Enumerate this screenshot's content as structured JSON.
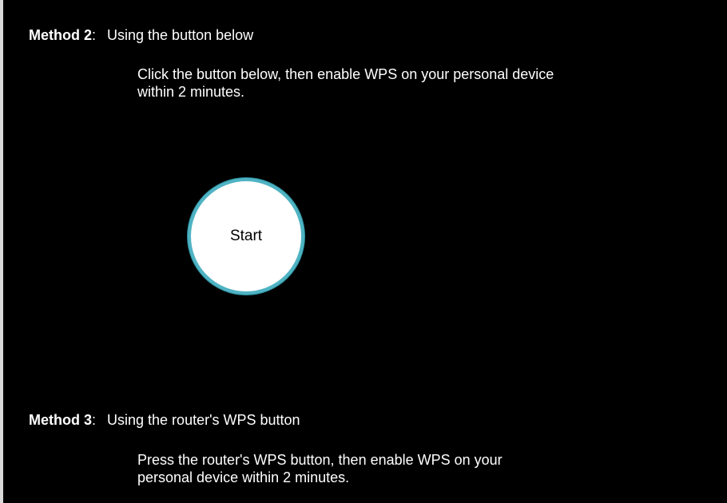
{
  "method2": {
    "label": "Method 2",
    "colon": ":",
    "title": "Using the button below",
    "description_line1": "Click the button below, then enable WPS on your personal device",
    "description_line2": "within 2 minutes.",
    "start_label": "Start"
  },
  "method3": {
    "label": "Method 3",
    "colon": ":",
    "title": "Using the router's WPS button",
    "description_line1": "Press the router's WPS button, then enable WPS on your",
    "description_line2": "personal device within 2 minutes."
  },
  "colors": {
    "background": "#000000",
    "text": "#ffffff",
    "button_fill": "#ffffff",
    "button_ring": "#4fb3c3"
  }
}
